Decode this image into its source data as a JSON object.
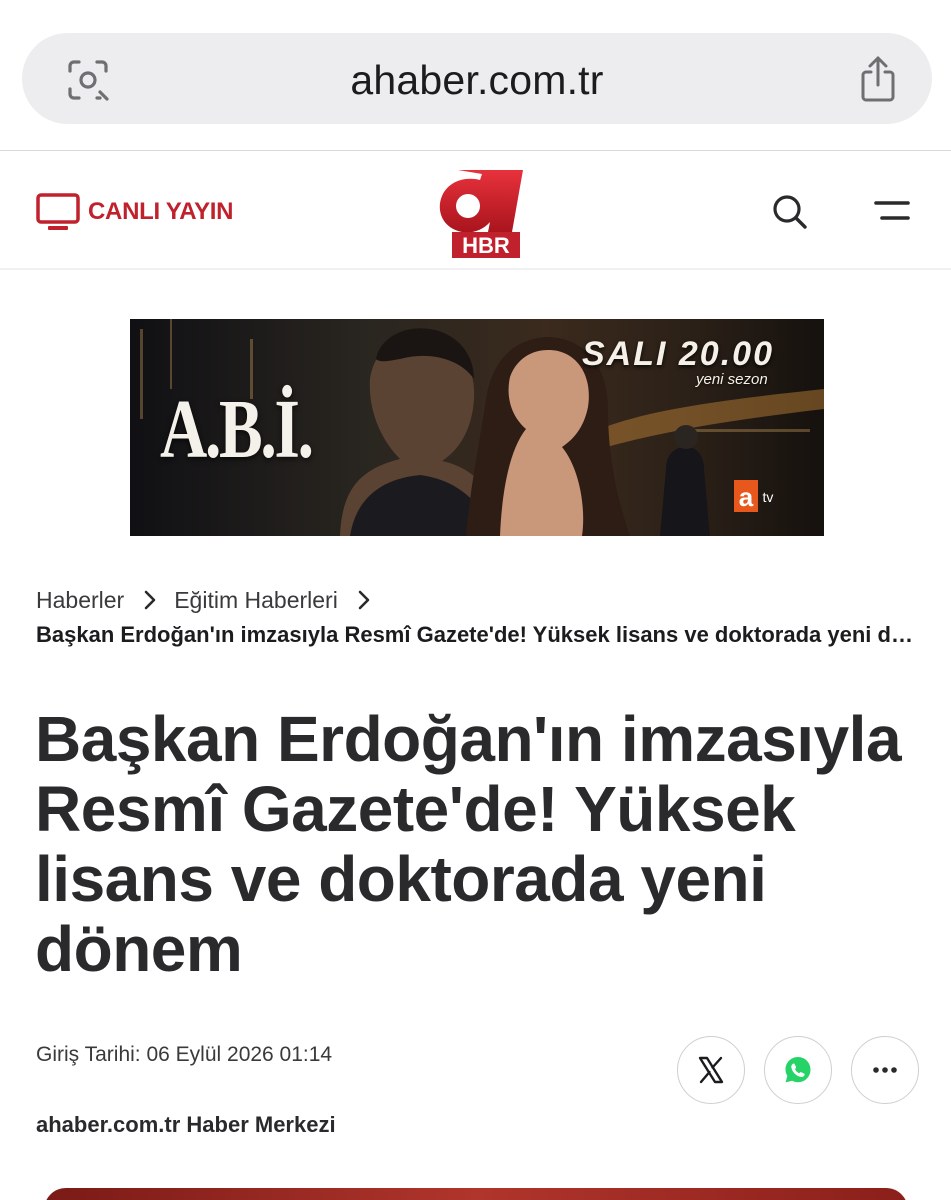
{
  "browser": {
    "url": "ahaber.com.tr",
    "lens_icon": "visual-search-icon",
    "share_icon": "share-icon"
  },
  "header": {
    "live_label": "CANLI YAYIN",
    "live_icon": "tv-icon",
    "logo_letter": "a",
    "logo_text": "HBR",
    "brand_color": "#c0212c",
    "search_icon": "search-icon",
    "menu_icon": "menu-icon"
  },
  "banner": {
    "show_title": "A.B.İ.",
    "airtime": "SALI 20.00",
    "season": "yeni sezon",
    "channel_letter": "a",
    "channel_suffix": "tv"
  },
  "breadcrumb": {
    "items": [
      "Haberler",
      "Eğitim Haberleri"
    ],
    "current": "Başkan Erdoğan'ın imzasıyla Resmî Gazete'de! Yüksek lisans ve doktorada yeni dönem"
  },
  "article": {
    "title": "Başkan Erdoğan'ın imzasıyla Resmî Gazete'de! Yüksek lisans ve doktorada yeni dönem",
    "date_text": "Giriş Tarihi: 06 Eylül 2026 01:14",
    "author": "ahaber.com.tr Haber Merkezi"
  },
  "share_buttons": [
    {
      "name": "x",
      "icon": "x-logo-icon"
    },
    {
      "name": "whatsapp",
      "icon": "whatsapp-icon",
      "color": "#25d366"
    },
    {
      "name": "more",
      "icon": "more-icon"
    }
  ]
}
